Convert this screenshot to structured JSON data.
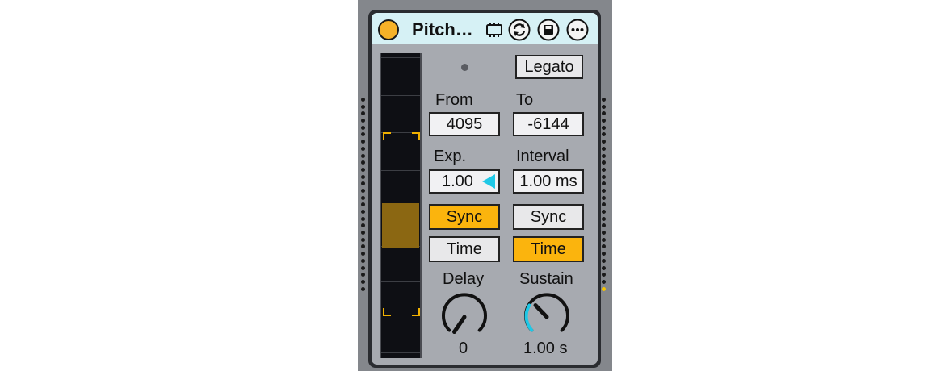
{
  "device": {
    "title": "Pitch…",
    "colors": {
      "accent": "#fbb40d",
      "header": "#d6f1f5",
      "panel": "#a7aab0",
      "knob_arc": "#1ec8e6"
    }
  },
  "header_icons": [
    "chip-icon",
    "hot-swap-icon",
    "save-icon",
    "more-icon"
  ],
  "controls": {
    "legacy_led": "",
    "legato": "Legato",
    "from_label": "From",
    "from_value": "4095",
    "to_label": "To",
    "to_value": "-6144",
    "exp_label": "Exp.",
    "exp_value": "1.00",
    "interval_label": "Interval",
    "interval_value": "1.00 ms",
    "left_sync": "Sync",
    "left_time": "Time",
    "right_sync": "Sync",
    "right_time": "Time",
    "left_mode_active": "Sync",
    "right_mode_active": "Time",
    "delay_label": "Delay",
    "delay_value": "0",
    "sustain_label": "Sustain",
    "sustain_value": "1.00 s"
  }
}
